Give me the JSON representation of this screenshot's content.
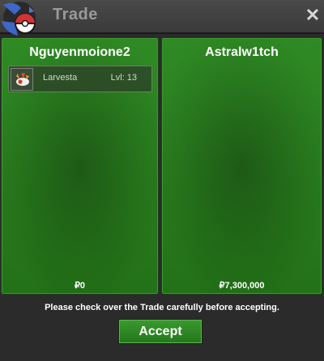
{
  "window": {
    "title": "Trade",
    "close_label": "✕"
  },
  "left_panel": {
    "name": "Nguyenmoione2",
    "pokemon": [
      {
        "name": "Larvesta",
        "level": "Lvl: 13"
      }
    ],
    "money": "₽0"
  },
  "right_panel": {
    "name": "Astralw1tch",
    "money": "₽7,300,000"
  },
  "notice": "Please check over the Trade carefully before accepting.",
  "accept_label": "Accept",
  "colors": {
    "panel_green": "#2f8a24",
    "titlebar": "#444444",
    "title_text": "#9a9a9a"
  }
}
